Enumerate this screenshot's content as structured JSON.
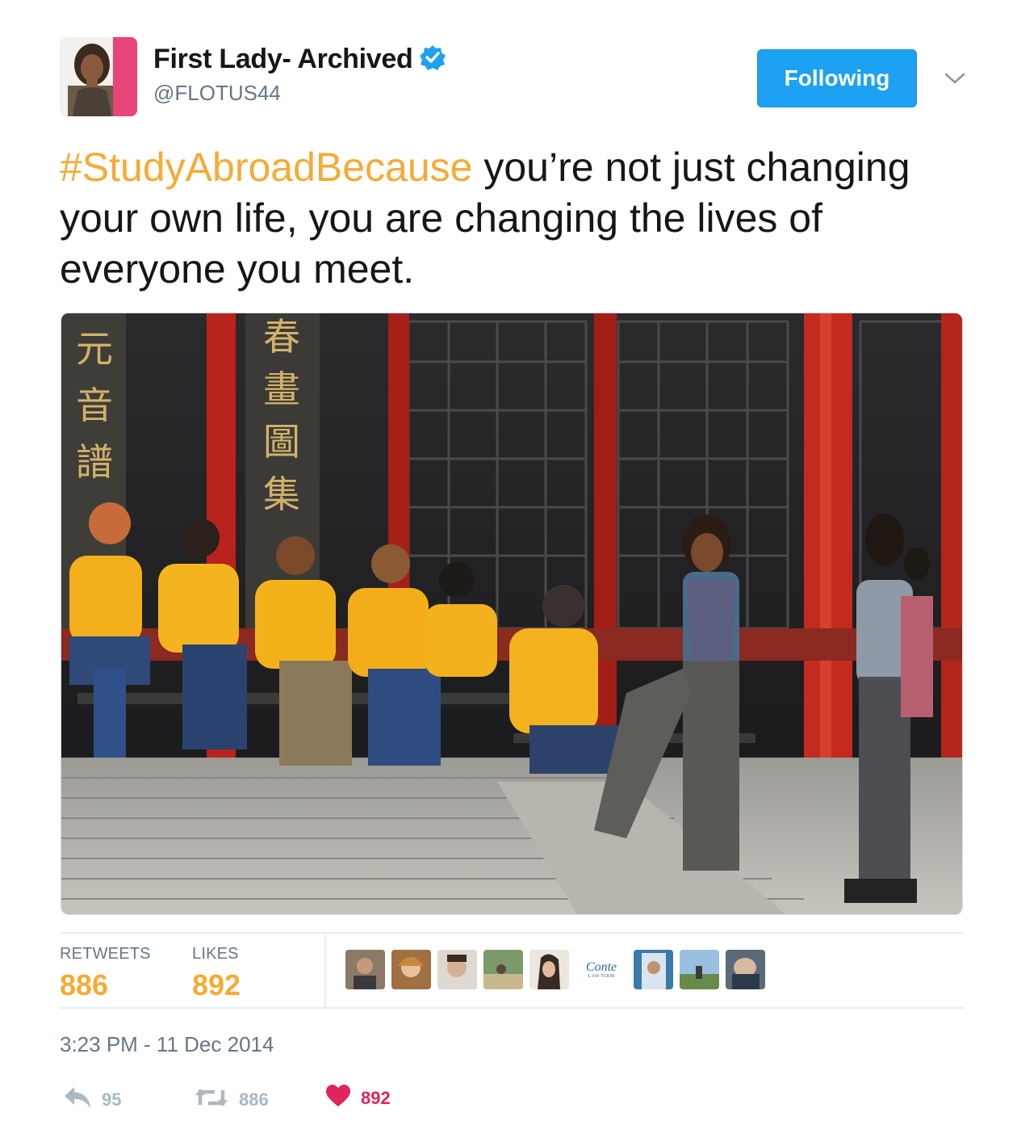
{
  "header": {
    "display_name": "First Lady- Archived",
    "handle": "@FLOTUS44",
    "verified_icon": "verified-badge-icon",
    "follow_button_label": "Following",
    "more_icon": "chevron-down-icon"
  },
  "tweet": {
    "hashtag": "#StudyAbroadBecause",
    "text": " you’re not just changing your own life, you are changing the lives of everyone you meet."
  },
  "stats": {
    "retweets_label": "RETWEETS",
    "retweets_value": "886",
    "likes_label": "LIKES",
    "likes_value": "892",
    "liker_badge_line1": "Conte",
    "liker_badge_line2": "LAW FIRM"
  },
  "timestamp": "3:23 PM - 11 Dec 2014",
  "actions": {
    "reply_icon": "reply-icon",
    "reply_count": "95",
    "retweet_icon": "retweet-icon",
    "retweet_count": "886",
    "like_icon": "heart-icon",
    "like_count": "892"
  },
  "colors": {
    "accent": "#f5ab35",
    "follow_blue": "#1da1f2",
    "like_red": "#e0245e",
    "muted": "#657786",
    "verified_blue": "#1da1f2"
  }
}
